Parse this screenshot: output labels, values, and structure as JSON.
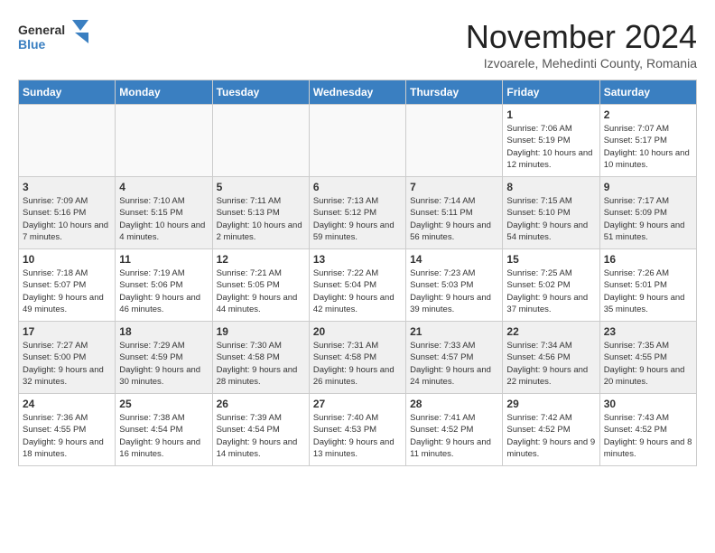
{
  "logo": {
    "text_general": "General",
    "text_blue": "Blue"
  },
  "title": "November 2024",
  "location": "Izvoarele, Mehedinti County, Romania",
  "days_of_week": [
    "Sunday",
    "Monday",
    "Tuesday",
    "Wednesday",
    "Thursday",
    "Friday",
    "Saturday"
  ],
  "weeks": [
    [
      {
        "day": "",
        "info": ""
      },
      {
        "day": "",
        "info": ""
      },
      {
        "day": "",
        "info": ""
      },
      {
        "day": "",
        "info": ""
      },
      {
        "day": "",
        "info": ""
      },
      {
        "day": "1",
        "info": "Sunrise: 7:06 AM\nSunset: 5:19 PM\nDaylight: 10 hours and 12 minutes."
      },
      {
        "day": "2",
        "info": "Sunrise: 7:07 AM\nSunset: 5:17 PM\nDaylight: 10 hours and 10 minutes."
      }
    ],
    [
      {
        "day": "3",
        "info": "Sunrise: 7:09 AM\nSunset: 5:16 PM\nDaylight: 10 hours and 7 minutes."
      },
      {
        "day": "4",
        "info": "Sunrise: 7:10 AM\nSunset: 5:15 PM\nDaylight: 10 hours and 4 minutes."
      },
      {
        "day": "5",
        "info": "Sunrise: 7:11 AM\nSunset: 5:13 PM\nDaylight: 10 hours and 2 minutes."
      },
      {
        "day": "6",
        "info": "Sunrise: 7:13 AM\nSunset: 5:12 PM\nDaylight: 9 hours and 59 minutes."
      },
      {
        "day": "7",
        "info": "Sunrise: 7:14 AM\nSunset: 5:11 PM\nDaylight: 9 hours and 56 minutes."
      },
      {
        "day": "8",
        "info": "Sunrise: 7:15 AM\nSunset: 5:10 PM\nDaylight: 9 hours and 54 minutes."
      },
      {
        "day": "9",
        "info": "Sunrise: 7:17 AM\nSunset: 5:09 PM\nDaylight: 9 hours and 51 minutes."
      }
    ],
    [
      {
        "day": "10",
        "info": "Sunrise: 7:18 AM\nSunset: 5:07 PM\nDaylight: 9 hours and 49 minutes."
      },
      {
        "day": "11",
        "info": "Sunrise: 7:19 AM\nSunset: 5:06 PM\nDaylight: 9 hours and 46 minutes."
      },
      {
        "day": "12",
        "info": "Sunrise: 7:21 AM\nSunset: 5:05 PM\nDaylight: 9 hours and 44 minutes."
      },
      {
        "day": "13",
        "info": "Sunrise: 7:22 AM\nSunset: 5:04 PM\nDaylight: 9 hours and 42 minutes."
      },
      {
        "day": "14",
        "info": "Sunrise: 7:23 AM\nSunset: 5:03 PM\nDaylight: 9 hours and 39 minutes."
      },
      {
        "day": "15",
        "info": "Sunrise: 7:25 AM\nSunset: 5:02 PM\nDaylight: 9 hours and 37 minutes."
      },
      {
        "day": "16",
        "info": "Sunrise: 7:26 AM\nSunset: 5:01 PM\nDaylight: 9 hours and 35 minutes."
      }
    ],
    [
      {
        "day": "17",
        "info": "Sunrise: 7:27 AM\nSunset: 5:00 PM\nDaylight: 9 hours and 32 minutes."
      },
      {
        "day": "18",
        "info": "Sunrise: 7:29 AM\nSunset: 4:59 PM\nDaylight: 9 hours and 30 minutes."
      },
      {
        "day": "19",
        "info": "Sunrise: 7:30 AM\nSunset: 4:58 PM\nDaylight: 9 hours and 28 minutes."
      },
      {
        "day": "20",
        "info": "Sunrise: 7:31 AM\nSunset: 4:58 PM\nDaylight: 9 hours and 26 minutes."
      },
      {
        "day": "21",
        "info": "Sunrise: 7:33 AM\nSunset: 4:57 PM\nDaylight: 9 hours and 24 minutes."
      },
      {
        "day": "22",
        "info": "Sunrise: 7:34 AM\nSunset: 4:56 PM\nDaylight: 9 hours and 22 minutes."
      },
      {
        "day": "23",
        "info": "Sunrise: 7:35 AM\nSunset: 4:55 PM\nDaylight: 9 hours and 20 minutes."
      }
    ],
    [
      {
        "day": "24",
        "info": "Sunrise: 7:36 AM\nSunset: 4:55 PM\nDaylight: 9 hours and 18 minutes."
      },
      {
        "day": "25",
        "info": "Sunrise: 7:38 AM\nSunset: 4:54 PM\nDaylight: 9 hours and 16 minutes."
      },
      {
        "day": "26",
        "info": "Sunrise: 7:39 AM\nSunset: 4:54 PM\nDaylight: 9 hours and 14 minutes."
      },
      {
        "day": "27",
        "info": "Sunrise: 7:40 AM\nSunset: 4:53 PM\nDaylight: 9 hours and 13 minutes."
      },
      {
        "day": "28",
        "info": "Sunrise: 7:41 AM\nSunset: 4:52 PM\nDaylight: 9 hours and 11 minutes."
      },
      {
        "day": "29",
        "info": "Sunrise: 7:42 AM\nSunset: 4:52 PM\nDaylight: 9 hours and 9 minutes."
      },
      {
        "day": "30",
        "info": "Sunrise: 7:43 AM\nSunset: 4:52 PM\nDaylight: 9 hours and 8 minutes."
      }
    ]
  ]
}
